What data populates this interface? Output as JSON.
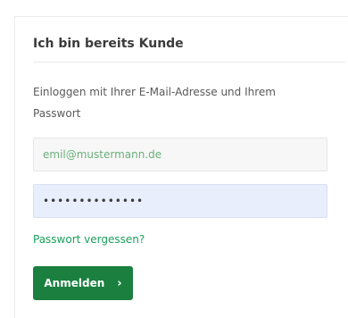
{
  "login": {
    "title": "Ich bin bereits Kunde",
    "description": "Einloggen mit Ihrer E-Mail-Adresse und Ihrem Passwort",
    "email_placeholder": "emil@mustermann.de",
    "password_value": "••••••••••••••",
    "forgot_link": "Passwort vergessen?",
    "submit_label": "Anmelden",
    "submit_icon": "chevron-right-icon"
  },
  "colors": {
    "accent": "#1a7f3f",
    "link": "#19a05a",
    "password_bg": "#e8eefc"
  }
}
